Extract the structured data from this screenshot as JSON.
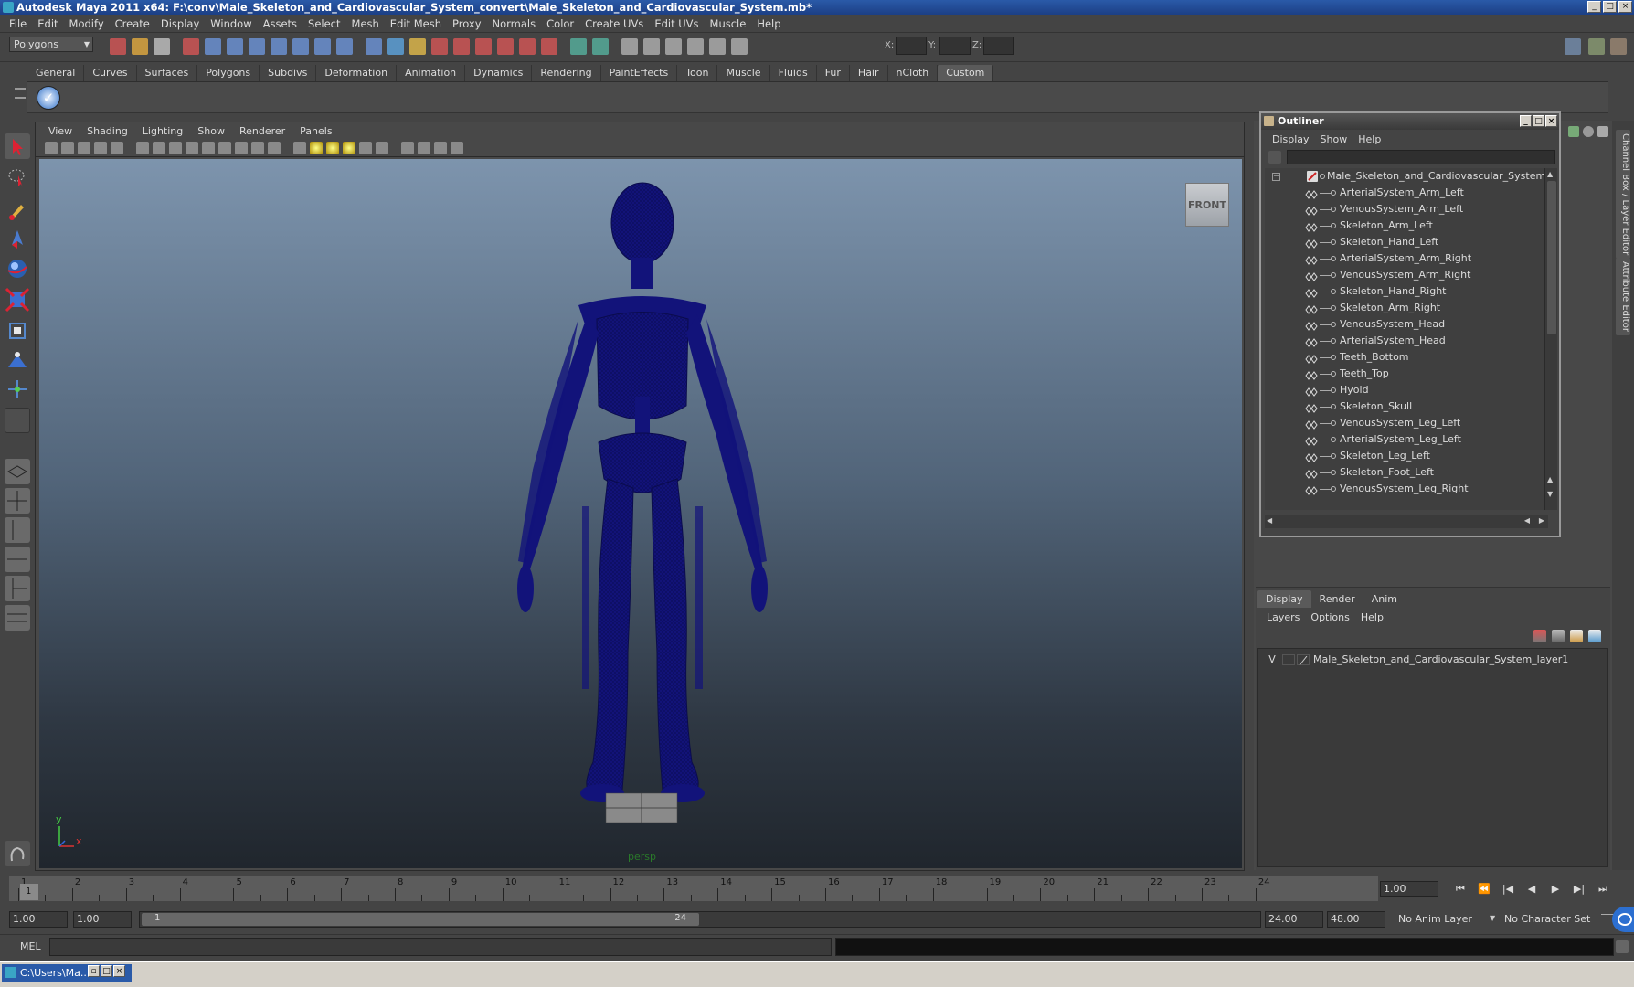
{
  "window": {
    "title": "Autodesk Maya 2011 x64: F:\\conv\\Male_Skeleton_and_Cardiovascular_System_convert\\Male_Skeleton_and_Cardiovascular_System.mb*",
    "min": "_",
    "max": "□",
    "close": "×"
  },
  "menubar": [
    "File",
    "Edit",
    "Modify",
    "Create",
    "Display",
    "Window",
    "Assets",
    "Select",
    "Mesh",
    "Edit Mesh",
    "Proxy",
    "Normals",
    "Color",
    "Create UVs",
    "Edit UVs",
    "Muscle",
    "Help"
  ],
  "statusline": {
    "mode": "Polygons",
    "x_label": "X:",
    "y_label": "Y:",
    "z_label": "Z:"
  },
  "shelf_tabs": [
    "General",
    "Curves",
    "Surfaces",
    "Polygons",
    "Subdivs",
    "Deformation",
    "Animation",
    "Dynamics",
    "Rendering",
    "PaintEffects",
    "Toon",
    "Muscle",
    "Fluids",
    "Fur",
    "Hair",
    "nCloth",
    "Custom"
  ],
  "shelf_active": "Custom",
  "viewport": {
    "menu": [
      "View",
      "Shading",
      "Lighting",
      "Show",
      "Renderer",
      "Panels"
    ],
    "cube_label": "FRONT",
    "camera": "persp",
    "axis_x": "x",
    "axis_y": "y",
    "mesh_color": "#12137a"
  },
  "outliner": {
    "title": "Outliner",
    "menu": [
      "Display",
      "Show",
      "Help"
    ],
    "root": "Male_Skeleton_and_Cardiovascular_System",
    "items": [
      "ArterialSystem_Arm_Left",
      "VenousSystem_Arm_Left",
      "Skeleton_Arm_Left",
      "Skeleton_Hand_Left",
      "ArterialSystem_Arm_Right",
      "VenousSystem_Arm_Right",
      "Skeleton_Hand_Right",
      "Skeleton_Arm_Right",
      "VenousSystem_Head",
      "ArterialSystem_Head",
      "Teeth_Bottom",
      "Teeth_Top",
      "Hyoid",
      "Skeleton_Skull",
      "VenousSystem_Leg_Left",
      "ArterialSystem_Leg_Left",
      "Skeleton_Leg_Left",
      "Skeleton_Foot_Left",
      "VenousSystem_Leg_Right"
    ]
  },
  "side_tabs": [
    "Channel Box / Layer Editor",
    "Attribute Editor"
  ],
  "layers": {
    "tabs": [
      "Display",
      "Render",
      "Anim"
    ],
    "menu": [
      "Layers",
      "Options",
      "Help"
    ],
    "row": {
      "visible": "V",
      "name": "Male_Skeleton_and_Cardiovascular_System_layer1"
    }
  },
  "timeline": {
    "ticks": [
      "1",
      "2",
      "3",
      "4",
      "5",
      "6",
      "7",
      "8",
      "9",
      "10",
      "11",
      "12",
      "13",
      "14",
      "15",
      "16",
      "17",
      "18",
      "19",
      "20",
      "21",
      "22",
      "23",
      "24"
    ],
    "current_marker": "1",
    "current_frame": "1.00",
    "playback": [
      "⏮",
      "⏪",
      "|◀",
      "◀",
      "▶",
      "▶|",
      "⏭"
    ]
  },
  "range": {
    "start": "1.00",
    "playstart": "1.00",
    "slider_start": "1",
    "slider_end": "24",
    "playend": "24.00",
    "end": "48.00",
    "anim_layer": "No Anim Layer",
    "char_set": "No Character Set"
  },
  "cmdline": {
    "label": "MEL"
  },
  "taskbar": {
    "label": "C:\\Users\\Ma..."
  }
}
